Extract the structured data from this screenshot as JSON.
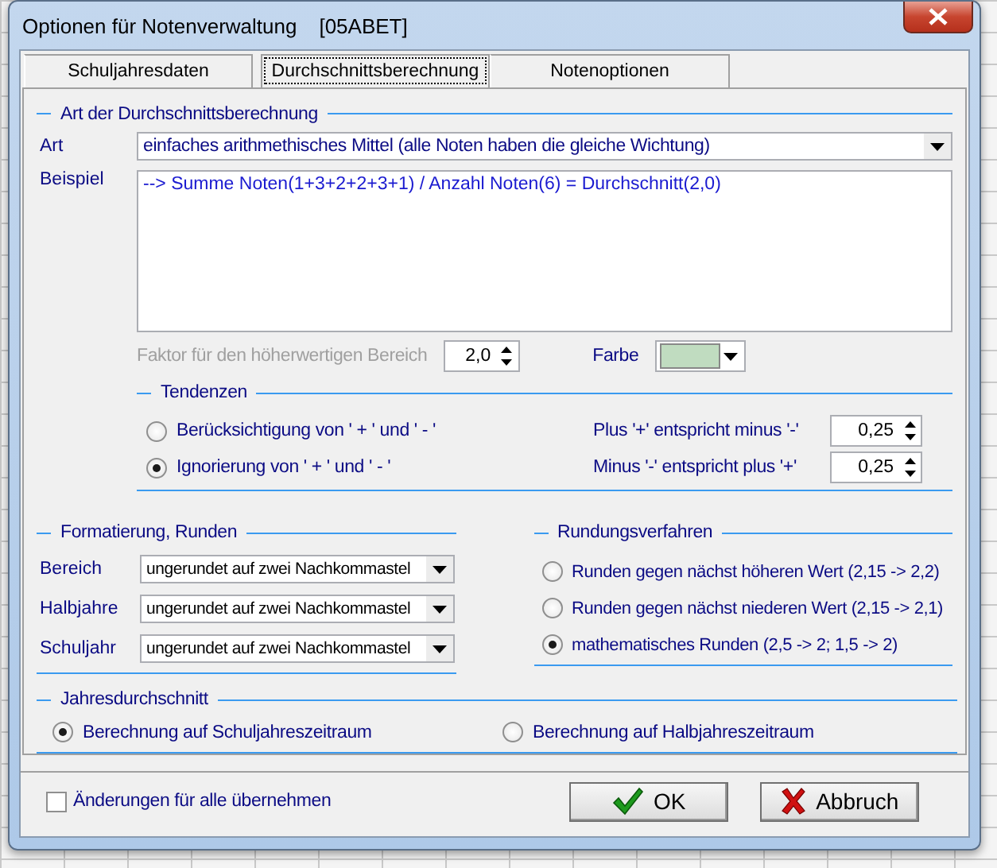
{
  "window": {
    "title": "Optionen für Notenverwaltung",
    "document": "[05ABET]"
  },
  "tabs": [
    {
      "label": "Schuljahresdaten",
      "selected": false
    },
    {
      "label": "Durchschnittsberechnung",
      "selected": true
    },
    {
      "label": "Notenoptionen",
      "selected": false
    }
  ],
  "averaging": {
    "legend": "Art der Durchschnittsberechnung",
    "type": {
      "label": "Art",
      "value": "einfaches arithmethisches Mittel (alle Noten haben die gleiche Wichtung)"
    },
    "example": {
      "label": "Beispiel",
      "value": "--> Summe Noten(1+3+2+2+3+1) / Anzahl Noten(6) = Durchschnitt(2,0)"
    },
    "factor": {
      "label": "Faktor für den höherwertigen Bereich",
      "value": "2,0",
      "disabled": true
    },
    "color": {
      "label": "Farbe",
      "color": "#c0dcc0"
    }
  },
  "tendencies": {
    "legend": "Tendenzen",
    "options": [
      {
        "label": "Berücksichtigung von ' + ' und ' - '",
        "selected": false
      },
      {
        "label": "Ignorierung von ' + ' und ' - '",
        "selected": true
      }
    ],
    "values": [
      {
        "label": "Plus '+' entspricht minus '-'",
        "value": "0,25"
      },
      {
        "label": "Minus '-' entspricht plus '+'",
        "value": "0,25"
      }
    ]
  },
  "formatting": {
    "legend": "Formatierung, Runden",
    "rows": [
      {
        "label": "Bereich",
        "value": "ungerundet auf zwei Nachkommastel"
      },
      {
        "label": "Halbjahre",
        "value": "ungerundet auf zwei Nachkommastel"
      },
      {
        "label": "Schuljahr",
        "value": "ungerundet auf zwei Nachkommastel"
      }
    ]
  },
  "rounding": {
    "legend": "Rundungsverfahren",
    "options": [
      {
        "label": "Runden gegen nächst höheren Wert (2,15 -> 2,2)",
        "selected": false
      },
      {
        "label": "Runden gegen nächst niederen Wert (2,15 -> 2,1)",
        "selected": false
      },
      {
        "label": "mathematisches Runden (2,5 -> 2; 1,5 -> 2)",
        "selected": true
      }
    ]
  },
  "annual": {
    "legend": "Jahresdurchschnitt",
    "options": [
      {
        "label": "Berechnung auf Schuljahreszeitraum",
        "selected": true
      },
      {
        "label": "Berechnung auf Halbjahreszeitraum",
        "selected": false
      }
    ]
  },
  "footer": {
    "apply_all": {
      "label": "Änderungen für alle übernehmen",
      "checked": false
    },
    "buttons": [
      {
        "label": "OK",
        "kind": "ok"
      },
      {
        "label": "Abbruch",
        "kind": "cancel"
      }
    ]
  }
}
